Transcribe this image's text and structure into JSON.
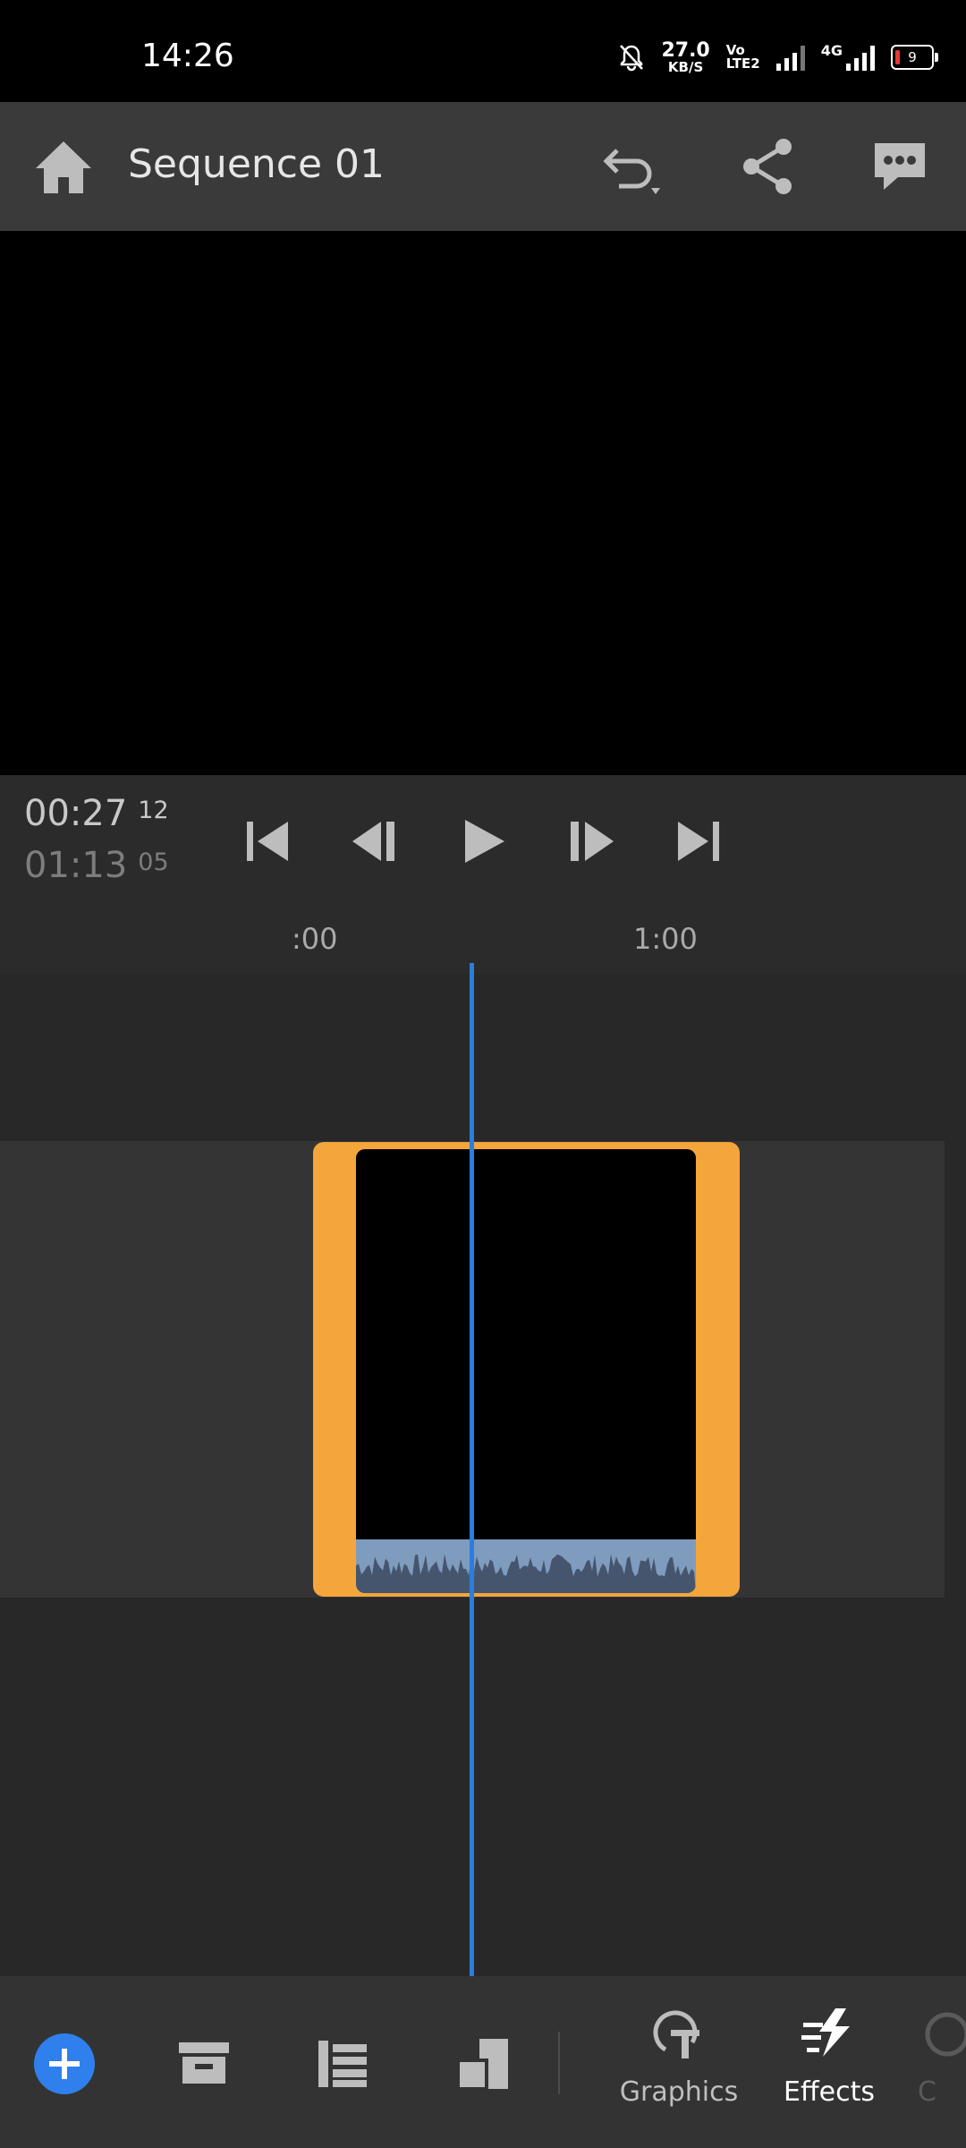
{
  "status_bar": {
    "time": "14:26",
    "net_speed_value": "27.0",
    "net_speed_unit": "KB/S",
    "volte_top": "Vo",
    "volte_bottom": "LTE2",
    "network_label": "4G",
    "battery_level": "9"
  },
  "header": {
    "title": "Sequence 01",
    "icons": [
      "home-icon",
      "undo-icon",
      "share-icon",
      "feedback-icon"
    ]
  },
  "transport": {
    "current_time": "00:27",
    "current_frames": "12",
    "duration_time": "01:13",
    "duration_frames": "05",
    "icons": [
      "skip-to-start-icon",
      "step-back-icon",
      "play-icon",
      "step-forward-icon",
      "skip-to-end-icon"
    ]
  },
  "ruler": {
    "marks": [
      ":00",
      "1:00"
    ]
  },
  "timeline": {
    "clip_selected": true
  },
  "bottom_bar": {
    "icons": [
      "add-icon",
      "media-box-icon",
      "list-icon",
      "aspect-ratio-icon"
    ],
    "tools": [
      {
        "label": "Graphics",
        "icon": "graphics-icon"
      },
      {
        "label": "Effects",
        "icon": "effects-icon",
        "active": true
      },
      {
        "label": "C",
        "icon": "color-icon"
      }
    ]
  },
  "colors": {
    "accent": "#2f80ed",
    "playhead": "#2b7ee0",
    "clip_border": "#f4a53c",
    "audio_waveform": "#7f9cbf"
  }
}
